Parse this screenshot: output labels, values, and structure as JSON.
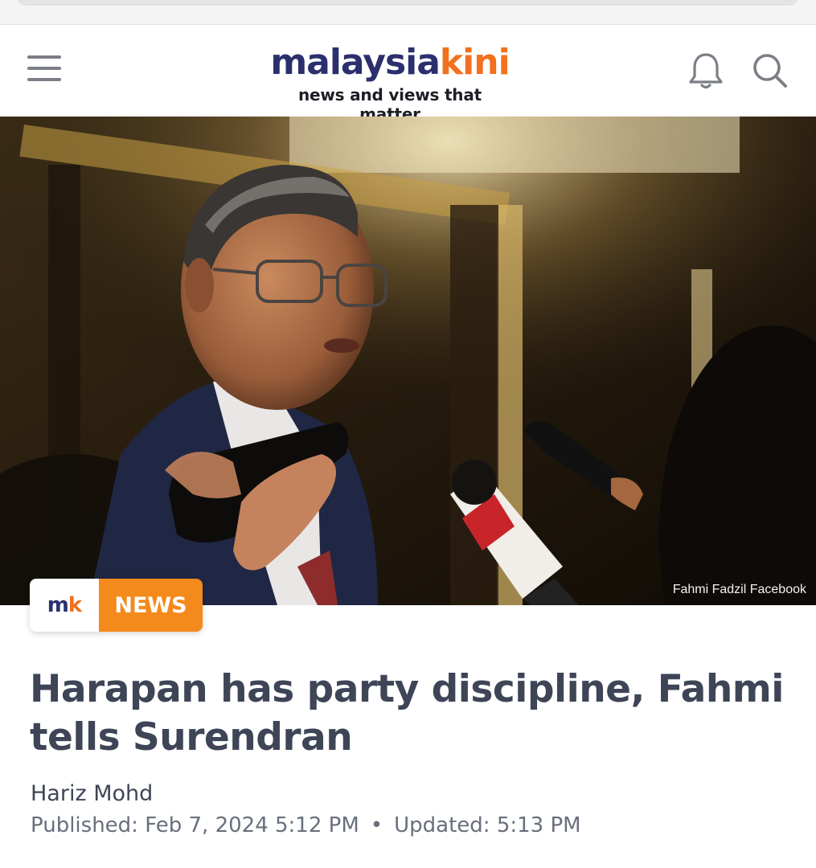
{
  "header": {
    "logo_part1": "malaysia",
    "logo_part2": "kini",
    "tagline": "news and views that matter",
    "brand_colors": {
      "navy": "#2b2f6e",
      "orange": "#f2701e"
    },
    "icons": [
      "menu-icon",
      "bell-icon",
      "search-icon"
    ]
  },
  "hero": {
    "credit": "Fahmi Fadzil Facebook"
  },
  "badge": {
    "logo_m": "m",
    "logo_k": "k",
    "label": "NEWS",
    "color": "#f48a1b"
  },
  "article": {
    "headline": "Harapan has party discipline, Fahmi tells Surendran",
    "author": "Hariz Mohd",
    "published_label": "Published:",
    "published_value": "Feb 7, 2024 5:12 PM",
    "separator": "•",
    "updated_label": "Updated:",
    "updated_value": "5:13 PM"
  }
}
